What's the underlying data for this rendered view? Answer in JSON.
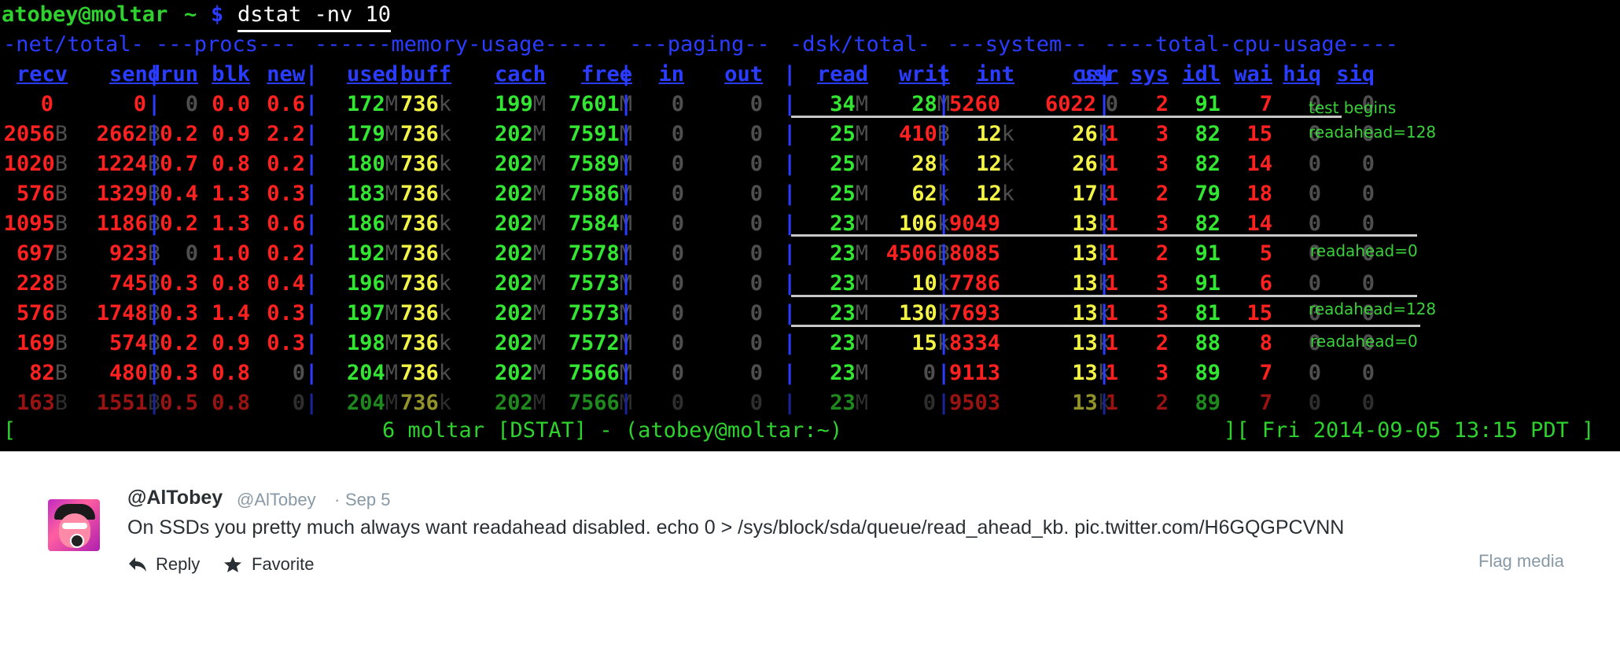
{
  "terminal": {
    "prompt": {
      "user_host": "atobey@moltar",
      "path": "~",
      "symbol": "$",
      "command": "dstat -nv 10"
    },
    "groups": [
      "-net/total-",
      "---procs---",
      "------memory-usage-----",
      "---paging--",
      "-dsk/total-",
      "---system--",
      "----total-cpu-usage----"
    ],
    "headers": [
      "recv",
      "send",
      "run",
      "blk",
      "new",
      "used",
      "buff",
      "cach",
      "free",
      "in",
      "out",
      "read",
      "writ",
      "int",
      "csw",
      "usr",
      "sys",
      "idl",
      "wai",
      "hiq",
      "siq"
    ],
    "rows": [
      [
        [
          "0",
          ""
        ],
        [
          "0",
          ""
        ],
        [
          "0",
          ""
        ],
        [
          "0.0",
          ""
        ],
        [
          "0.6",
          ""
        ],
        [
          "172",
          "M"
        ],
        [
          "736",
          "k"
        ],
        [
          "199",
          "M"
        ],
        [
          "7601",
          "M"
        ],
        [
          "0",
          ""
        ],
        [
          "0",
          ""
        ],
        [
          "34",
          "M"
        ],
        [
          "28",
          "M"
        ],
        [
          "5260",
          ""
        ],
        [
          "6022",
          ""
        ],
        [
          "0",
          ""
        ],
        [
          "2",
          ""
        ],
        [
          "91",
          ""
        ],
        [
          "7",
          ""
        ],
        [
          "0",
          ""
        ],
        [
          "0",
          ""
        ]
      ],
      [
        [
          "2056",
          "B"
        ],
        [
          "2662",
          "B"
        ],
        [
          "0.2",
          ""
        ],
        [
          "0.9",
          ""
        ],
        [
          "2.2",
          ""
        ],
        [
          "179",
          "M"
        ],
        [
          "736",
          "k"
        ],
        [
          "202",
          "M"
        ],
        [
          "7591",
          "M"
        ],
        [
          "0",
          ""
        ],
        [
          "0",
          ""
        ],
        [
          "25",
          "M"
        ],
        [
          "410",
          "B"
        ],
        [
          "12",
          "k"
        ],
        [
          "26",
          "k"
        ],
        [
          "1",
          ""
        ],
        [
          "3",
          ""
        ],
        [
          "82",
          ""
        ],
        [
          "15",
          ""
        ],
        [
          "0",
          ""
        ],
        [
          "0",
          ""
        ]
      ],
      [
        [
          "1020",
          "B"
        ],
        [
          "1224",
          "B"
        ],
        [
          "0.7",
          ""
        ],
        [
          "0.8",
          ""
        ],
        [
          "0.2",
          ""
        ],
        [
          "180",
          "M"
        ],
        [
          "736",
          "k"
        ],
        [
          "202",
          "M"
        ],
        [
          "7589",
          "M"
        ],
        [
          "0",
          ""
        ],
        [
          "0",
          ""
        ],
        [
          "25",
          "M"
        ],
        [
          "28",
          "k"
        ],
        [
          "12",
          "k"
        ],
        [
          "26",
          "k"
        ],
        [
          "1",
          ""
        ],
        [
          "3",
          ""
        ],
        [
          "82",
          ""
        ],
        [
          "14",
          ""
        ],
        [
          "0",
          ""
        ],
        [
          "0",
          ""
        ]
      ],
      [
        [
          "576",
          "B"
        ],
        [
          "1329",
          "B"
        ],
        [
          "0.4",
          ""
        ],
        [
          "1.3",
          ""
        ],
        [
          "0.3",
          ""
        ],
        [
          "183",
          "M"
        ],
        [
          "736",
          "k"
        ],
        [
          "202",
          "M"
        ],
        [
          "7586",
          "M"
        ],
        [
          "0",
          ""
        ],
        [
          "0",
          ""
        ],
        [
          "25",
          "M"
        ],
        [
          "62",
          "k"
        ],
        [
          "12",
          "k"
        ],
        [
          "17",
          "k"
        ],
        [
          "1",
          ""
        ],
        [
          "2",
          ""
        ],
        [
          "79",
          ""
        ],
        [
          "18",
          ""
        ],
        [
          "0",
          ""
        ],
        [
          "0",
          ""
        ]
      ],
      [
        [
          "1095",
          "B"
        ],
        [
          "1186",
          "B"
        ],
        [
          "0.2",
          ""
        ],
        [
          "1.3",
          ""
        ],
        [
          "0.6",
          ""
        ],
        [
          "186",
          "M"
        ],
        [
          "736",
          "k"
        ],
        [
          "202",
          "M"
        ],
        [
          "7584",
          "M"
        ],
        [
          "0",
          ""
        ],
        [
          "0",
          ""
        ],
        [
          "23",
          "M"
        ],
        [
          "106",
          "k"
        ],
        [
          "9049",
          ""
        ],
        [
          "13",
          "k"
        ],
        [
          "1",
          ""
        ],
        [
          "3",
          ""
        ],
        [
          "82",
          ""
        ],
        [
          "14",
          ""
        ],
        [
          "0",
          ""
        ],
        [
          "0",
          ""
        ]
      ],
      [
        [
          "697",
          "B"
        ],
        [
          "923",
          "B"
        ],
        [
          "0",
          ""
        ],
        [
          "1.0",
          ""
        ],
        [
          "0.2",
          ""
        ],
        [
          "192",
          "M"
        ],
        [
          "736",
          "k"
        ],
        [
          "202",
          "M"
        ],
        [
          "7578",
          "M"
        ],
        [
          "0",
          ""
        ],
        [
          "0",
          ""
        ],
        [
          "23",
          "M"
        ],
        [
          "4506",
          "B"
        ],
        [
          "8085",
          ""
        ],
        [
          "13",
          "k"
        ],
        [
          "1",
          ""
        ],
        [
          "2",
          ""
        ],
        [
          "91",
          ""
        ],
        [
          "5",
          ""
        ],
        [
          "0",
          ""
        ],
        [
          "0",
          ""
        ]
      ],
      [
        [
          "228",
          "B"
        ],
        [
          "745",
          "B"
        ],
        [
          "0.3",
          ""
        ],
        [
          "0.8",
          ""
        ],
        [
          "0.4",
          ""
        ],
        [
          "196",
          "M"
        ],
        [
          "736",
          "k"
        ],
        [
          "202",
          "M"
        ],
        [
          "7573",
          "M"
        ],
        [
          "0",
          ""
        ],
        [
          "0",
          ""
        ],
        [
          "23",
          "M"
        ],
        [
          "10",
          "k"
        ],
        [
          "7786",
          ""
        ],
        [
          "13",
          "k"
        ],
        [
          "1",
          ""
        ],
        [
          "3",
          ""
        ],
        [
          "91",
          ""
        ],
        [
          "6",
          ""
        ],
        [
          "0",
          ""
        ],
        [
          "0",
          ""
        ]
      ],
      [
        [
          "576",
          "B"
        ],
        [
          "1748",
          "B"
        ],
        [
          "0.3",
          ""
        ],
        [
          "1.4",
          ""
        ],
        [
          "0.3",
          ""
        ],
        [
          "197",
          "M"
        ],
        [
          "736",
          "k"
        ],
        [
          "202",
          "M"
        ],
        [
          "7573",
          "M"
        ],
        [
          "0",
          ""
        ],
        [
          "0",
          ""
        ],
        [
          "23",
          "M"
        ],
        [
          "130",
          "k"
        ],
        [
          "7693",
          ""
        ],
        [
          "13",
          "k"
        ],
        [
          "1",
          ""
        ],
        [
          "3",
          ""
        ],
        [
          "81",
          ""
        ],
        [
          "15",
          ""
        ],
        [
          "0",
          ""
        ],
        [
          "0",
          ""
        ]
      ],
      [
        [
          "169",
          "B"
        ],
        [
          "574",
          "B"
        ],
        [
          "0.2",
          ""
        ],
        [
          "0.9",
          ""
        ],
        [
          "0.3",
          ""
        ],
        [
          "198",
          "M"
        ],
        [
          "736",
          "k"
        ],
        [
          "202",
          "M"
        ],
        [
          "7572",
          "M"
        ],
        [
          "0",
          ""
        ],
        [
          "0",
          ""
        ],
        [
          "23",
          "M"
        ],
        [
          "15",
          "k"
        ],
        [
          "8334",
          ""
        ],
        [
          "13",
          "k"
        ],
        [
          "1",
          ""
        ],
        [
          "2",
          ""
        ],
        [
          "88",
          ""
        ],
        [
          "8",
          ""
        ],
        [
          "0",
          ""
        ],
        [
          "0",
          ""
        ]
      ],
      [
        [
          "82",
          "B"
        ],
        [
          "480",
          "B"
        ],
        [
          "0.3",
          ""
        ],
        [
          "0.8",
          ""
        ],
        [
          "0",
          ""
        ],
        [
          "204",
          "M"
        ],
        [
          "736",
          "k"
        ],
        [
          "202",
          "M"
        ],
        [
          "7566",
          "M"
        ],
        [
          "0",
          ""
        ],
        [
          "0",
          ""
        ],
        [
          "23",
          "M"
        ],
        [
          "0",
          ""
        ],
        [
          "9113",
          ""
        ],
        [
          "13",
          "k"
        ],
        [
          "1",
          ""
        ],
        [
          "3",
          ""
        ],
        [
          "89",
          ""
        ],
        [
          "7",
          ""
        ],
        [
          "0",
          ""
        ],
        [
          "0",
          ""
        ]
      ],
      [
        [
          "163",
          "B"
        ],
        [
          "1551",
          "B"
        ],
        [
          "0.5",
          ""
        ],
        [
          "0.8",
          ""
        ],
        [
          "0",
          ""
        ],
        [
          "204",
          "M"
        ],
        [
          "736",
          "k"
        ],
        [
          "202",
          "M"
        ],
        [
          "7566",
          "M"
        ],
        [
          "0",
          ""
        ],
        [
          "0",
          ""
        ],
        [
          "23",
          "M"
        ],
        [
          "0",
          ""
        ],
        [
          "9503",
          ""
        ],
        [
          "13",
          "k"
        ],
        [
          "1",
          ""
        ],
        [
          "2",
          ""
        ],
        [
          "89",
          ""
        ],
        [
          "7",
          ""
        ],
        [
          "0",
          ""
        ],
        [
          "0",
          ""
        ]
      ]
    ],
    "annotations": [
      "test begins",
      "readahead=128",
      "readahead=0",
      "readahead=128",
      "readahead=0"
    ],
    "status_left": "[",
    "status_center": "6 moltar [DSTAT] - (atobey@moltar:~)",
    "status_right": "][ Fri 2014-09-05 13:15 PDT ]",
    "colors": {
      "green": "#32e632",
      "yellow": "#f4f447",
      "red": "#ff2020",
      "blue": "#2a3cff",
      "gray": "#4e4e4e"
    }
  },
  "tweet": {
    "display_name": "@AlTobey",
    "handle": "@AlTobey",
    "dot": "·",
    "date": "Sep 5",
    "text": "On SSDs you pretty much always want readahead disabled. echo 0 > /sys/block/sda/queue/read_ahead_kb. ",
    "link": "pic.twitter.com/H6GQGPCVNN",
    "reply_label": "Reply",
    "favorite_label": "Favorite",
    "flag_label": "Flag media",
    "icons": {
      "reply": "reply-icon",
      "favorite": "star-icon"
    }
  }
}
